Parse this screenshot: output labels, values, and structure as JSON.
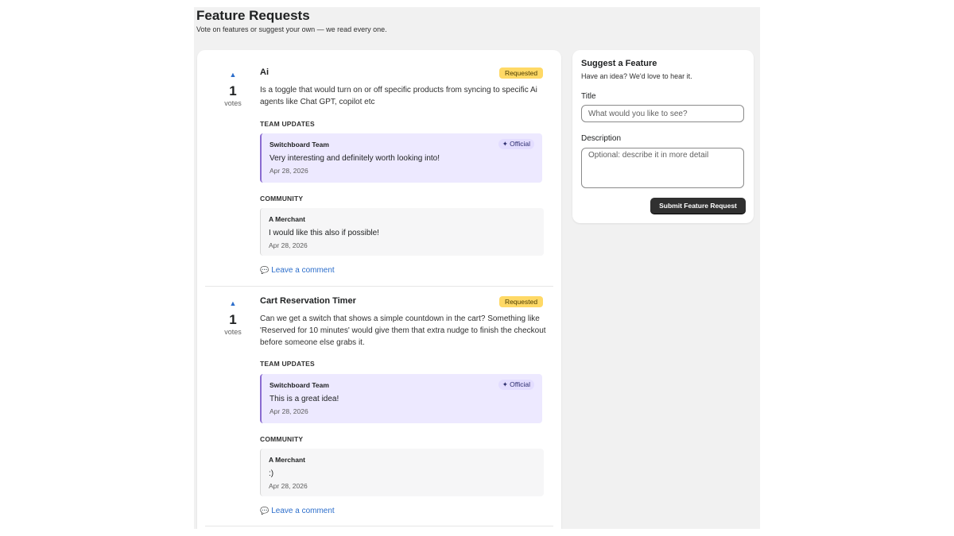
{
  "page": {
    "title": "Feature Requests",
    "subtitle": "Vote on features or suggest your own — we read every one."
  },
  "requests": [
    {
      "vote_icon": "▲",
      "votes": "1",
      "votes_label": "votes",
      "title": "Ai",
      "status": "Requested",
      "description": "Is a toggle that would turn on or off specific products from syncing to specific Ai agents like Chat GPT, copilot etc",
      "team_label": "TEAM UPDATES",
      "team_update": {
        "author": "Switchboard Team",
        "badge": "✦ Official",
        "message": "Very interesting and definitely worth looking into!",
        "date": "Apr 28, 2026"
      },
      "community_label": "COMMUNITY",
      "comment": {
        "author": "A Merchant",
        "message": "I would like this also if possible!",
        "date": "Apr 28, 2026"
      },
      "leave_comment": "Leave a comment"
    },
    {
      "vote_icon": "▲",
      "votes": "1",
      "votes_label": "votes",
      "title": "Cart Reservation Timer",
      "status": "Requested",
      "description": "Can we get a switch that shows a simple countdown in the cart? Something like 'Reserved for 10 minutes' would give them that extra nudge to finish the checkout before someone else grabs it.",
      "team_label": "TEAM UPDATES",
      "team_update": {
        "author": "Switchboard Team",
        "badge": "✦ Official",
        "message": "This is a great idea!",
        "date": "Apr 28, 2026"
      },
      "community_label": "COMMUNITY",
      "comment": {
        "author": "A Merchant",
        "message": ":)",
        "date": "Apr 28, 2026"
      },
      "leave_comment": "Leave a comment"
    }
  ],
  "icons": {
    "vote": "upvote-triangle-icon",
    "comment": "speech-bubble-icon"
  },
  "suggest": {
    "title": "Suggest a Feature",
    "subtitle": "Have an idea? We'd love to hear it.",
    "title_label": "Title",
    "title_placeholder": "What would you like to see?",
    "description_label": "Description",
    "description_placeholder": "Optional: describe it in more detail",
    "submit_label": "Submit Feature Request"
  },
  "colors": {
    "accent_link": "#2c6ecb",
    "badge_requested": "#ffd966",
    "official_update_bg": "#ede9ff",
    "official_border": "#8a6bd1",
    "submit_bg": "#303030"
  }
}
